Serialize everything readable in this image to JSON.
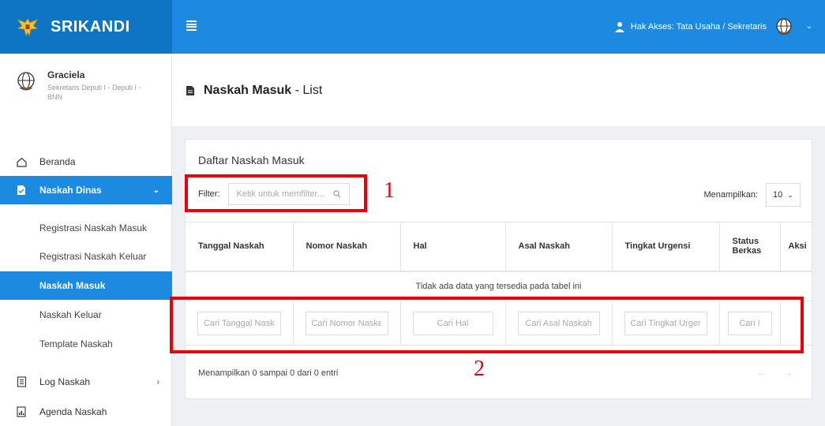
{
  "brand": {
    "title": "SRIKANDI"
  },
  "topbar": {
    "access_label": "Hak Akses: Tata Usaha / Sekretaris"
  },
  "profile": {
    "name": "Graciela",
    "role": "Sekretaris Deputi I - Deputi I - BNN"
  },
  "sidebar": {
    "items": [
      {
        "label": "Beranda",
        "icon": "home-icon"
      },
      {
        "label": "Naskah Dinas",
        "icon": "document-icon"
      },
      {
        "label": "Log Naskah",
        "icon": "log-icon"
      },
      {
        "label": "Agenda Naskah",
        "icon": "agenda-icon"
      }
    ],
    "subitems": [
      {
        "label": "Registrasi Naskah Masuk"
      },
      {
        "label": "Registrasi Naskah Keluar"
      },
      {
        "label": "Naskah Masuk"
      },
      {
        "label": "Naskah Keluar"
      },
      {
        "label": "Template Naskah"
      }
    ]
  },
  "page": {
    "title_bold": "Naskah Masuk",
    "title_rest": " - List"
  },
  "card": {
    "title": "Daftar Naskah Masuk",
    "filter_label": "Filter:",
    "filter_placeholder": "Ketik untuk memfilter...",
    "show_label": "Menampilkan:",
    "show_value": "10",
    "columns": [
      "Tanggal Naskah",
      "Nomor Naskah",
      "Hal",
      "Asal Naskah",
      "Tingkat Urgensi",
      "Status Berkas",
      "Aksi"
    ],
    "empty_text": "Tidak ada data yang tersedia pada tabel ini",
    "search_placeholders": [
      "Cari Tanggal Nask",
      "Cari Nomor Naskε",
      "Cari Hal",
      "Cari Asal Naskah",
      "Cari Tingkat Urger",
      "Cari !"
    ],
    "info": "Menampilkan 0 sampai 0 dari 0 entri",
    "pager": "← →"
  },
  "annotations": {
    "one": "1",
    "two": "2"
  },
  "colors": {
    "brand": "#0e74c4",
    "topbar": "#1b8ae0",
    "active": "#1b8ae0",
    "annotation": "#e8000b"
  }
}
